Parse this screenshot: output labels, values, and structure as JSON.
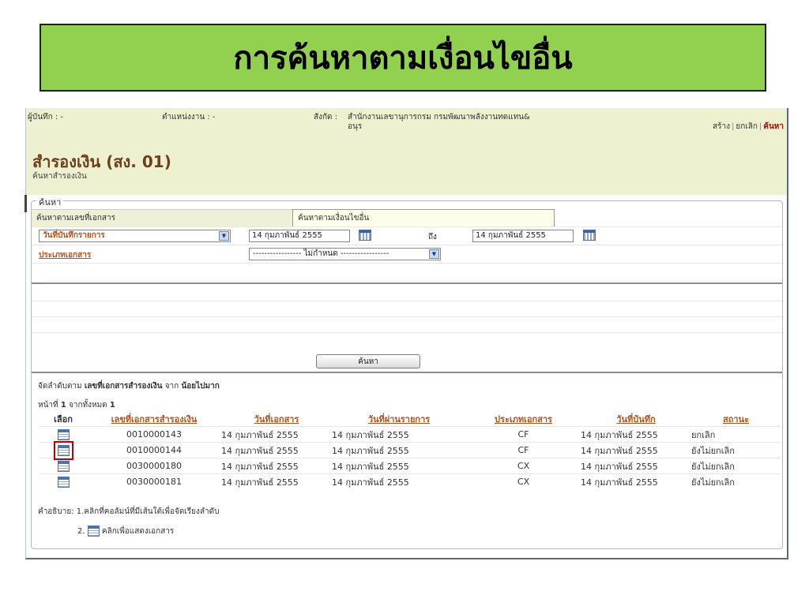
{
  "banner_title": "การค้นหาตามเงื่อนไขอื่น",
  "header": {
    "recorder": "ผู้บันทึก : -",
    "position": "ตำแหน่งงาน : -",
    "affiliation_label": "สังกัด :",
    "affiliation_value_line1": "สำนักงานเลขานุการกรม กรมพัฒนาพลังงานทดแทน&",
    "affiliation_value_line2": "อนุร",
    "actions": {
      "create": "สร้าง",
      "cancel": "ยกเลิก",
      "search": "ค้นหา"
    }
  },
  "page": {
    "title": "สำรองเงิน (สง. 01)",
    "subtitle": "ค้นหาสำรองเงิน"
  },
  "search_panel": {
    "legend": "ค้นหา",
    "tabs": [
      "ค้นหาตามเลขที่เอกสาร",
      "ค้นหาตามเงื่อนไขอื่น"
    ],
    "date_type_select": "วันที่บันทึกรายการ",
    "date_from": "14 กุมภาพันธ์ 2555",
    "to_label": "ถึง",
    "date_to": "14 กุมภาพันธ์ 2555",
    "doc_type_label": "ประเภทเอกสาร",
    "doc_type_select": "----------------- ไม่กำหนด -----------------",
    "search_button": "ค้นหา",
    "sort_prefix": "จัดลำดับตาม",
    "sort_field": "เลขที่เอกสารสำรองเงิน",
    "sort_middle": "จาก",
    "sort_order": "น้อยไปมาก",
    "page_prefix": "หน้าที่",
    "page_current": "1",
    "page_middle": "จากทั้งหมด",
    "page_total": "1"
  },
  "results": {
    "columns": [
      "เลือก",
      "เลขที่เอกสารสำรองเงิน",
      "วันที่เอกสาร",
      "วันที่ผ่านรายการ",
      "ประเภทเอกสาร",
      "วันที่บันทึก",
      "สถานะ"
    ],
    "rows": [
      {
        "doc_no": "0010000143",
        "doc_date": "14 กุมภาพันธ์ 2555",
        "post_date": "14 กุมภาพันธ์ 2555",
        "doc_type": "CF",
        "record_date": "14 กุมภาพันธ์ 2555",
        "status": "ยกเลิก"
      },
      {
        "doc_no": "0010000144",
        "doc_date": "14 กุมภาพันธ์ 2555",
        "post_date": "14 กุมภาพันธ์ 2555",
        "doc_type": "CF",
        "record_date": "14 กุมภาพันธ์ 2555",
        "status": "ยังไม่ยกเลิก"
      },
      {
        "doc_no": "0030000180",
        "doc_date": "14 กุมภาพันธ์ 2555",
        "post_date": "14 กุมภาพันธ์ 2555",
        "doc_type": "CX",
        "record_date": "14 กุมภาพันธ์ 2555",
        "status": "ยังไม่ยกเลิก"
      },
      {
        "doc_no": "0030000181",
        "doc_date": "14 กุมภาพันธ์ 2555",
        "post_date": "14 กุมภาพันธ์ 2555",
        "doc_type": "CX",
        "record_date": "14 กุมภาพันธ์ 2555",
        "status": "ยังไม่ยกเลิก"
      }
    ]
  },
  "notes": {
    "label": "คำอธิบาย:",
    "item1": "1.คลิกที่คอลัมน์ที่มีเส้นใต้เพื่อจัดเรียงลำดับ",
    "item2_num": "2.",
    "item2_text": "คลิกเพื่อแสดงเอกสาร"
  },
  "icons": {
    "view_document": "document-icon",
    "calendar": "calendar-icon",
    "dropdown": "chevron-down-icon"
  },
  "colors": {
    "banner_bg": "#92d050",
    "header_bg": "#eef1cf",
    "title_brown": "#6d3f1c",
    "link_orange": "#b5521b",
    "highlight_red": "#c00000"
  }
}
